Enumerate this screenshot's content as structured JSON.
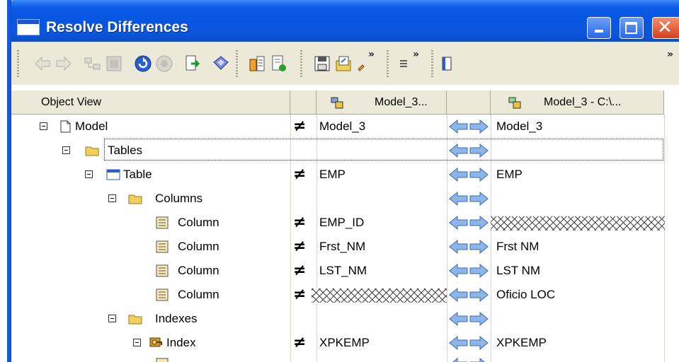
{
  "window": {
    "title": "Resolve Differences",
    "title_color": "#0a5ae8"
  },
  "toolbar": {
    "overflow_label": "»"
  },
  "grid": {
    "headers": {
      "object_view": "Object View",
      "left_model": "Model_3...",
      "right_model": "Model_3 - C:\\..."
    },
    "rows": [
      {
        "object": "Model",
        "left": "Model_3",
        "right": "Model_3",
        "diff": "≠"
      },
      {
        "object": "Tables",
        "left": "",
        "right": ""
      },
      {
        "object": "Table",
        "left": "EMP",
        "right": "EMP",
        "diff": "≠"
      },
      {
        "object": "Columns",
        "left": "",
        "right": ""
      },
      {
        "object": "Column",
        "left": "EMP_ID",
        "right": "",
        "diff": "≠"
      },
      {
        "object": "Column",
        "left": "Frst_NM",
        "right": "Frst NM",
        "diff": "≠"
      },
      {
        "object": "Column",
        "left": "LST_NM",
        "right": "LST NM",
        "diff": "≠"
      },
      {
        "object": "Column",
        "left": "",
        "right": "Oficio LOC",
        "diff": "≠"
      },
      {
        "object": "Indexes",
        "left": "",
        "right": ""
      },
      {
        "object": "Index",
        "left": "XPKEMP",
        "right": "XPKEMP",
        "diff": "≠"
      }
    ]
  },
  "colors": {
    "hatch": "#444444",
    "arrow": "#8eb5e8",
    "folder": "#f2cf5a"
  }
}
